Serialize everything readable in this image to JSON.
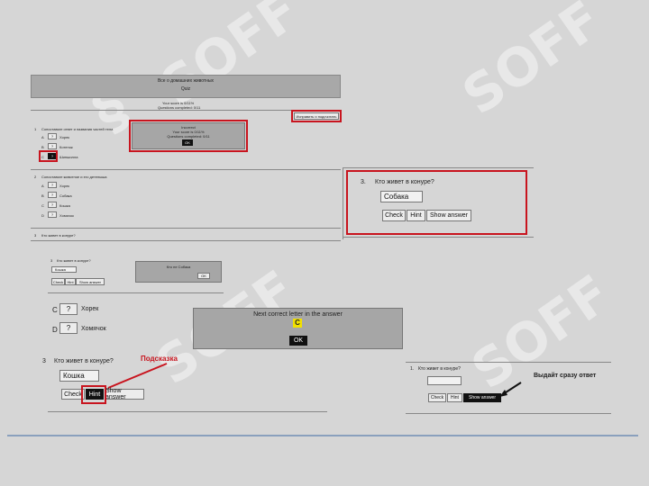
{
  "watermark": "SOFF",
  "worksheet": {
    "title": "Все о домашних животных",
    "subtitle": "Quiz",
    "score_line": "Your score is 0/11%",
    "questions_line": "Questions completed: 0/11",
    "submit_button": "Исправить и подсчитать"
  },
  "mini_dialog": {
    "line1": "Incorrect",
    "line2": "Your score is 0/11%",
    "line3": "Questions completed: 0/11",
    "ok": "OK"
  },
  "q1": {
    "number": "1",
    "text": "Сопоставьте ответ и названия частей тела",
    "rows": [
      {
        "letter": "A",
        "choice": "?",
        "label": "Хорек"
      },
      {
        "letter": "B",
        "choice": "?",
        "label": "Котенок"
      },
      {
        "letter": "C",
        "choice": "?",
        "label": "Шиншилла"
      }
    ]
  },
  "q2": {
    "number": "2",
    "text": "Сопоставьте животное и его детеныша",
    "rows": [
      {
        "letter": "A",
        "choice": "?",
        "label": "Хорек"
      },
      {
        "letter": "B",
        "choice": "?",
        "label": "Собака"
      },
      {
        "letter": "C",
        "choice": "?",
        "label": "Кошка"
      },
      {
        "letter": "D",
        "choice": "?",
        "label": "Хомячок"
      }
    ]
  },
  "q3_mini": {
    "number": "3",
    "text": "Кто живет в конуре?"
  },
  "panel_mid": {
    "number": "3",
    "question": "Кто живет в конуре?",
    "answer": "Кошка",
    "check": "Check",
    "hint": "Hint",
    "show": "Show answer",
    "dialog_text": "Кто не Собака",
    "dialog_ok": "OK"
  },
  "zoom_match": {
    "rows": [
      {
        "letter": "C",
        "choice": "?",
        "label": "Хорек"
      },
      {
        "letter": "D",
        "choice": "?",
        "label": "Хомячок"
      }
    ]
  },
  "next_letter_dialog": {
    "message": "Next correct letter in the answer",
    "letter": "C",
    "ok": "OK"
  },
  "hint_panel": {
    "annotation": "Подсказка",
    "number": "3",
    "question": "Кто живет в конуре?",
    "answer": "Кошка",
    "check": "Check",
    "hint": "Hint",
    "show": "Show answer"
  },
  "right_panel": {
    "number": "3.",
    "question": "Кто живет в конуре?",
    "answer": "Собака",
    "check": "Check",
    "hint": "Hint",
    "show": "Show answer"
  },
  "show_panel": {
    "number": "1.",
    "question": "Кто живет в конуре?",
    "answer": "",
    "check": "Check",
    "hint": "Hint",
    "show": "Show answer",
    "annotation": "Выдайт сразу ответ"
  },
  "colors": {
    "background": "#d6d6d6",
    "highlight_red": "#c8141e",
    "header_gray": "#a8a8a8"
  }
}
